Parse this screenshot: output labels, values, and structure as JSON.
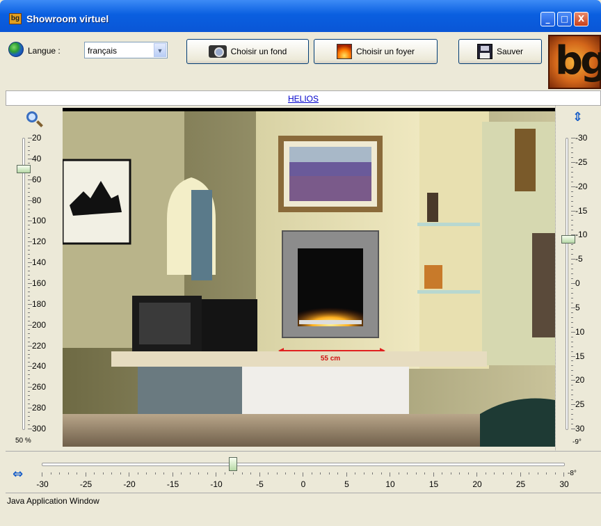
{
  "window": {
    "title": "Showroom virtuel",
    "icon_text": "bg",
    "controls": {
      "minimize": "_",
      "maximize": "□",
      "close": "X"
    }
  },
  "toolbar": {
    "language_label": "Langue :",
    "language_value": "français",
    "choose_background": "Choisir un fond",
    "choose_fireplace": "Choisir un foyer",
    "save": "Sauver",
    "logo_text": "bg"
  },
  "model_name": "HELIOS",
  "zoom": {
    "ticks": [
      "20",
      "40",
      "60",
      "80",
      "100",
      "120",
      "140",
      "160",
      "180",
      "200",
      "220",
      "240",
      "260",
      "280",
      "300"
    ],
    "value": 50,
    "percent_label": "50 %"
  },
  "vertical": {
    "ticks": [
      "-30",
      "-25",
      "-20",
      "-15",
      "-10",
      "-5",
      "0",
      "5",
      "10",
      "15",
      "20",
      "25",
      "30"
    ],
    "value": -9,
    "degree_label": "-9°"
  },
  "horizontal": {
    "ticks": [
      "-30",
      "-25",
      "-20",
      "-15",
      "-10",
      "-5",
      "0",
      "5",
      "10",
      "15",
      "20",
      "25",
      "30"
    ],
    "value": -8,
    "degree_label": "-8°"
  },
  "measure_label": "55 cm",
  "status_text": "Java Application Window",
  "colors": {
    "title_bar": "#0a5fe0",
    "link": "#0000cc",
    "measure_arrow": "#e02020",
    "measure_bg": "#ffff00"
  }
}
